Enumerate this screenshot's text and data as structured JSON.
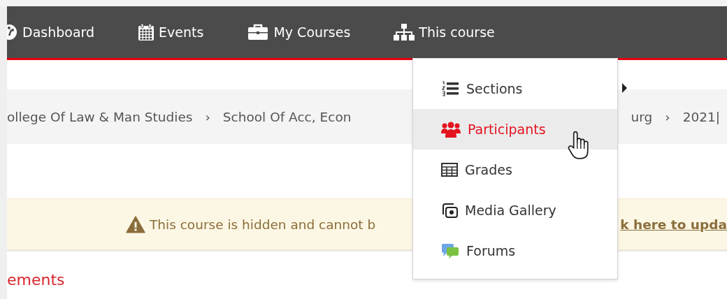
{
  "nav": {
    "items": [
      {
        "kind": "dashboard",
        "label": "Dashboard"
      },
      {
        "kind": "calendar",
        "label": "Events"
      },
      {
        "kind": "briefcase",
        "label": "My Courses"
      },
      {
        "kind": "sitemap",
        "label": "This course"
      }
    ]
  },
  "breadcrumb": {
    "items": [
      {
        "kind": "link",
        "text": "ollege Of Law & Man Studies"
      },
      {
        "kind": "separator",
        "text": "›"
      },
      {
        "kind": "link",
        "text": "School Of Acc, Econ"
      },
      {
        "kind": "link",
        "text": "urg"
      },
      {
        "kind": "separator",
        "text": "›"
      },
      {
        "kind": "link",
        "text": "2021|"
      }
    ]
  },
  "alert": {
    "text": "This course is hidden and cannot b",
    "link": "k here to upda"
  },
  "heading": "ements",
  "dropdown": {
    "items": [
      {
        "kind": "sections",
        "label": "Sections",
        "selected": false
      },
      {
        "kind": "participants",
        "label": "Participants",
        "selected": true
      },
      {
        "kind": "grades",
        "label": "Grades",
        "selected": false
      },
      {
        "kind": "media",
        "label": "Media Gallery",
        "selected": false
      },
      {
        "kind": "forums",
        "label": "Forums",
        "selected": false
      }
    ]
  }
}
